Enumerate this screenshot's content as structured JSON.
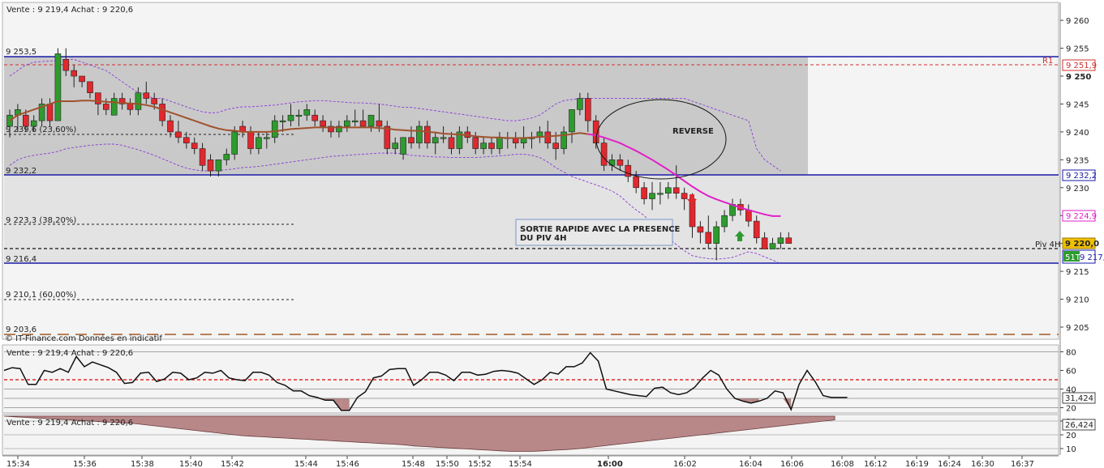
{
  "header": {
    "main_quote": "Vente : 9 219,4 Achat : 9 220,6",
    "rsi_quote": "Vente : 9 219,4 Achat : 9 220,6",
    "osc_quote": "Vente : 9 219,4 Achat : 9 220,6",
    "credit": "© IT-Finance.com  Données en indicatif"
  },
  "annotations": {
    "reverse": "REVERSE",
    "sortie_line1": "SORTIE RAPIDE AVEC LA PRESENCE",
    "sortie_line2": "DU PIV 4H",
    "pivot_label": "Piv 4H",
    "r1_label": "R1"
  },
  "levels": {
    "l1": "9 253,5",
    "l2": "9 239,6 (23,60%)",
    "l3": "9 232,2",
    "l4": "9 223,3 (38,20%)",
    "l5": "9 216,4",
    "l6": "9 210,1 (60,00%)",
    "l7": "9 203,6"
  },
  "price_tags": {
    "r1": "9 251,9",
    "upper": "9 232,2",
    "ma": "9 224,9",
    "last": "9 220,0",
    "count": "51T",
    "lower": "9 217,1",
    "rsi_value": "31,424",
    "osc_value": "26,424"
  },
  "colors": {
    "up": "#2e9b2e",
    "down": "#e0282e",
    "ma": "#e020c8",
    "band": "#8a3cd6",
    "level": "#1a1aa8",
    "zone": "#c9c9c9",
    "rsi_mid": "#e00000",
    "osc_fill": "#b88888"
  },
  "chart_data": {
    "type": "candlestick",
    "y_ticks": [
      "9 260",
      "9 255",
      "9 250",
      "9 245",
      "9 240",
      "9 235",
      "9 230",
      "9 225",
      "9 220",
      "9 215",
      "9 210",
      "9 205"
    ],
    "y_bold": "9 250",
    "x_ticks": [
      "15:34",
      "15:36",
      "15:38",
      "15:40",
      "15:42",
      "15:44",
      "15:46",
      "15:48",
      "15:50",
      "15:52",
      "15:54",
      "16:00",
      "16:02",
      "16:04",
      "16:06",
      "16:08",
      "16:12",
      "16:19",
      "16:24",
      "16:30",
      "16:37"
    ],
    "x_bold": "16:00",
    "ylim": [
      9202,
      9262
    ],
    "candles": [
      [
        9241,
        9244,
        9239,
        9243
      ],
      [
        9243,
        9245,
        9240,
        9244
      ],
      [
        9243,
        9244,
        9240,
        9241
      ],
      [
        9241,
        9243,
        9240,
        9242
      ],
      [
        9242,
        9246,
        9241,
        9245
      ],
      [
        9245,
        9246,
        9241,
        9242
      ],
      [
        9242,
        9255,
        9242,
        9254
      ],
      [
        9253,
        9255,
        9250,
        9251
      ],
      [
        9251,
        9252,
        9248,
        9250
      ],
      [
        9250,
        9250,
        9248,
        9249
      ],
      [
        9249,
        9249,
        9246,
        9247
      ],
      [
        9247,
        9247,
        9243,
        9245
      ],
      [
        9245,
        9246,
        9243,
        9244
      ],
      [
        9243,
        9247,
        9243,
        9246
      ],
      [
        9246,
        9247,
        9244,
        9245
      ],
      [
        9245,
        9246,
        9243,
        9244
      ],
      [
        9244,
        9248,
        9243,
        9247
      ],
      [
        9247,
        9249,
        9245,
        9246
      ],
      [
        9246,
        9247,
        9244,
        9245
      ],
      [
        9245,
        9246,
        9241,
        9242
      ],
      [
        9242,
        9243,
        9239,
        9240
      ],
      [
        9240,
        9242,
        9238,
        9239
      ],
      [
        9239,
        9240,
        9237,
        9238
      ],
      [
        9238,
        9239,
        9236,
        9237
      ],
      [
        9237,
        9238,
        9233,
        9234
      ],
      [
        9235,
        9236,
        9232,
        9233
      ],
      [
        9233,
        9235,
        9232,
        9235
      ],
      [
        9235,
        9237,
        9234,
        9236
      ],
      [
        9236,
        9241,
        9235,
        9240
      ],
      [
        9241,
        9242,
        9239,
        9240
      ],
      [
        9240,
        9241,
        9236,
        9237
      ],
      [
        9237,
        9240,
        9236,
        9239
      ],
      [
        9239,
        9240,
        9237,
        9239
      ],
      [
        9239,
        9243,
        9238,
        9242
      ],
      [
        9242,
        9243,
        9240,
        9242
      ],
      [
        9242,
        9245,
        9241,
        9243
      ],
      [
        9243,
        9244,
        9241,
        9243
      ],
      [
        9243,
        9245,
        9242,
        9244
      ],
      [
        9243,
        9244,
        9241,
        9242
      ],
      [
        9242,
        9243,
        9240,
        9241
      ],
      [
        9241,
        9242,
        9239,
        9240
      ],
      [
        9240,
        9242,
        9239,
        9241
      ],
      [
        9241,
        9243,
        9240,
        9242
      ],
      [
        9242,
        9244,
        9241,
        9242
      ],
      [
        9242,
        9244,
        9241,
        9241
      ],
      [
        9241,
        9243,
        9240,
        9243
      ],
      [
        9242,
        9245,
        9240,
        9241
      ],
      [
        9241,
        9242,
        9236,
        9237
      ],
      [
        9237,
        9239,
        9236,
        9238
      ],
      [
        9236,
        9239,
        9235,
        9239
      ],
      [
        9239,
        9241,
        9237,
        9238
      ],
      [
        9238,
        9242,
        9237,
        9241
      ],
      [
        9241,
        9242,
        9237,
        9238
      ],
      [
        9238,
        9240,
        9236,
        9239
      ],
      [
        9239,
        9241,
        9238,
        9239
      ],
      [
        9239,
        9240,
        9236,
        9237
      ],
      [
        9237,
        9241,
        9236,
        9240
      ],
      [
        9240,
        9241,
        9238,
        9239
      ],
      [
        9239,
        9240,
        9236,
        9237
      ],
      [
        9237,
        9239,
        9236,
        9238
      ],
      [
        9238,
        9239,
        9236,
        9237
      ],
      [
        9237,
        9240,
        9236,
        9239
      ],
      [
        9239,
        9240,
        9237,
        9239
      ],
      [
        9239,
        9240,
        9237,
        9238
      ],
      [
        9238,
        9241,
        9237,
        9239
      ],
      [
        9239,
        9240,
        9237,
        9239
      ],
      [
        9239,
        9241,
        9238,
        9240
      ],
      [
        9240,
        9242,
        9237,
        9238
      ],
      [
        9238,
        9240,
        9235,
        9237
      ],
      [
        9237,
        9241,
        9236,
        9240
      ],
      [
        9240,
        9244,
        9238,
        9244
      ],
      [
        9244,
        9247,
        9243,
        9246
      ],
      [
        9246,
        9247,
        9240,
        9242
      ],
      [
        9242,
        9243,
        9237,
        9238
      ],
      [
        9238,
        9239,
        9233,
        9234
      ],
      [
        9234,
        9236,
        9233,
        9235
      ],
      [
        9235,
        9236,
        9233,
        9234
      ],
      [
        9234,
        9235,
        9231,
        9232
      ],
      [
        9232,
        9233,
        9229,
        9230
      ],
      [
        9230,
        9231,
        9227,
        9228
      ],
      [
        9228,
        9231,
        9226,
        9229
      ],
      [
        9229,
        9231,
        9227,
        9229
      ],
      [
        9229,
        9231,
        9228,
        9230
      ],
      [
        9230,
        9234,
        9228,
        9229
      ],
      [
        9229,
        9230,
        9226,
        9228
      ],
      [
        9228,
        9229,
        9221,
        9223
      ],
      [
        9223,
        9224,
        9220,
        9222
      ],
      [
        9222,
        9225,
        9219,
        9220
      ],
      [
        9220,
        9224,
        9217,
        9223
      ],
      [
        9223,
        9226,
        9222,
        9225
      ],
      [
        9225,
        9228,
        9224,
        9227
      ],
      [
        9227,
        9228,
        9225,
        9226
      ],
      [
        9226,
        9227,
        9223,
        9224
      ],
      [
        9224,
        9225,
        9220,
        9221
      ],
      [
        9221,
        9222,
        9219,
        9219
      ],
      [
        9219,
        9221,
        9219,
        9220
      ],
      [
        9220,
        9222,
        9219,
        9221
      ],
      [
        9221,
        9222,
        9220,
        9220
      ]
    ],
    "ma_series": [
      9242,
      9243,
      9243.5,
      9244,
      9244.5,
      9245,
      9245.5,
      9245.5,
      9245.5,
      9245.6,
      9245.6,
      9245.5,
      9245.4,
      9245.3,
      9245.2,
      9245.1,
      9245,
      9244.8,
      9244.5,
      9244,
      9243.5,
      9243,
      9242.5,
      9242,
      9241.5,
      9241,
      9240.6,
      9240.3,
      9240.2,
      9240,
      9240,
      9240,
      9240,
      9240.1,
      9240.3,
      9240.5,
      9240.6,
      9240.7,
      9240.8,
      9240.8,
      9240.8,
      9240.8,
      9240.8,
      9240.8,
      9240.8,
      9240.8,
      9240.7,
      9240.6,
      9240.4,
      9240.3,
      9240.2,
      9240.2,
      9240,
      9239.9,
      9239.7,
      9239.6,
      9239.5,
      9239.4,
      9239.2,
      9239.1,
      9239,
      9239,
      9238.9,
      9238.9,
      9238.9,
      9239,
      9239.1,
      9239.2,
      9239.3,
      9239.4,
      9239.6,
      9239.8,
      9239.6,
      9239.4,
      9239,
      9238.5,
      9238,
      9237.3,
      9236.6,
      9235.8,
      9235,
      9234.1,
      9233.2,
      9232.2,
      9231.2,
      9230.2,
      9229.3,
      9228.5,
      9227.9,
      9227.4,
      9226.9,
      9226.4,
      9226,
      9225.6,
      9225.2,
      9224.9,
      9224.9
    ],
    "band_upper": [
      9250,
      9251,
      9252,
      9252.5,
      9252.6,
      9252.7,
      9252.8,
      9253,
      9253,
      9252.5,
      9252,
      9251.5,
      9251,
      9250,
      9249,
      9248,
      9247,
      9246.5,
      9246,
      9246,
      9245.5,
      9245,
      9244.5,
      9244,
      9243.6,
      9243.4,
      9243.5,
      9244,
      9244.3,
      9244.5,
      9244.5,
      9244.6,
      9244.7,
      9244.8,
      9245,
      9245.2,
      9245.4,
      9245.5,
      9245.6,
      9245.6,
      9245.5,
      9245.4,
      9245.3,
      9245.2,
      9245.2,
      9245.1,
      9245,
      9244.8,
      9244.6,
      9244.4,
      9244.4,
      9244.2,
      9244,
      9243.8,
      9243.6,
      9243.4,
      9243.2,
      9243,
      9242.8,
      9242.6,
      9242.4,
      9242.2,
      9242,
      9242,
      9242.2,
      9242.5,
      9243,
      9244,
      9245,
      9245.6,
      9245.8,
      9246,
      9246,
      9246,
      9246,
      9246,
      9246,
      9246,
      9246,
      9246,
      9246,
      9246,
      9246,
      9246,
      9246,
      9245.5,
      9245,
      9244.5,
      9244,
      9243.5,
      9243,
      9242.5,
      9242,
      9237,
      9235,
      9234,
      9233
    ],
    "band_lower": [
      9234,
      9235,
      9235.5,
      9235.8,
      9236,
      9236.2,
      9236.5,
      9237,
      9237.2,
      9237.4,
      9237.6,
      9237.7,
      9237.8,
      9237.8,
      9237.6,
      9237.2,
      9236.8,
      9236.3,
      9235.8,
      9235.2,
      9234.6,
      9234,
      9233.5,
      9233.2,
      9233,
      9233,
      9233.1,
      9233.2,
      9233.4,
      9233.6,
      9233.7,
      9233.8,
      9234,
      9234.2,
      9234.4,
      9234.6,
      9234.8,
      9235,
      9235.2,
      9235.4,
      9235.6,
      9235.7,
      9235.8,
      9235.9,
      9236,
      9236.1,
      9236.2,
      9236.2,
      9236.2,
      9236,
      9235.8,
      9235.7,
      9235.6,
      9235.5,
      9235.5,
      9235.4,
      9235.4,
      9235.4,
      9235.4,
      9235.5,
      9235.6,
      9235.7,
      9235.8,
      9236,
      9236,
      9235.8,
      9235.4,
      9234.6,
      9233.6,
      9232.8,
      9232,
      9231.5,
      9231,
      9230.5,
      9230,
      9229.4,
      9228.5,
      9227.2,
      9226,
      9225,
      9223.5,
      9222.2,
      9221,
      9219.8,
      9218.7,
      9217.8,
      9217.5,
      9217.3,
      9217.2,
      9217.3,
      9217.5,
      9218,
      9218.5,
      9218.2,
      9217.6,
      9217,
      9216.4
    ],
    "rsi": [
      60,
      63,
      62,
      45,
      45,
      60,
      58,
      62,
      58,
      75,
      64,
      69,
      66,
      63,
      58,
      46,
      47,
      57,
      58,
      48,
      51,
      58,
      57,
      50,
      52,
      58,
      57,
      60,
      52,
      50,
      49,
      58,
      58,
      55,
      47,
      44,
      38,
      38,
      33,
      31,
      28,
      28,
      17,
      17,
      31,
      37,
      52,
      54,
      61,
      62,
      62,
      44,
      50,
      58,
      58,
      55,
      49,
      58,
      58,
      55,
      56,
      59,
      60,
      59,
      57,
      51,
      45,
      50,
      58,
      56,
      64,
      64,
      68,
      79,
      70,
      40,
      38,
      36,
      34,
      33,
      32,
      41,
      42,
      36,
      34,
      36,
      42,
      52,
      60,
      55,
      40,
      30,
      27,
      25,
      27,
      30,
      38,
      36,
      18,
      45,
      60,
      48,
      33,
      31,
      31,
      31
    ],
    "rsi_ticks": [
      "80",
      "60",
      "40",
      "20"
    ],
    "osc": [
      80,
      79,
      78,
      77,
      76,
      75,
      74,
      73,
      72,
      71,
      70,
      69,
      68,
      66,
      64,
      62,
      60,
      58,
      56,
      54,
      52,
      50,
      48,
      47,
      46,
      45,
      44,
      43,
      42,
      41,
      40,
      39,
      38,
      37,
      36,
      35,
      34,
      33,
      31,
      30,
      29,
      28,
      27,
      26,
      25,
      24,
      23,
      22,
      22,
      22,
      23,
      24,
      25,
      26,
      28,
      30,
      32,
      34,
      36,
      38,
      40,
      42,
      44,
      46,
      48,
      50,
      52,
      54,
      56,
      58,
      60,
      62,
      64,
      66,
      68,
      70,
      72,
      74
    ],
    "osc_ticks": [
      "30",
      "20",
      "10"
    ]
  }
}
